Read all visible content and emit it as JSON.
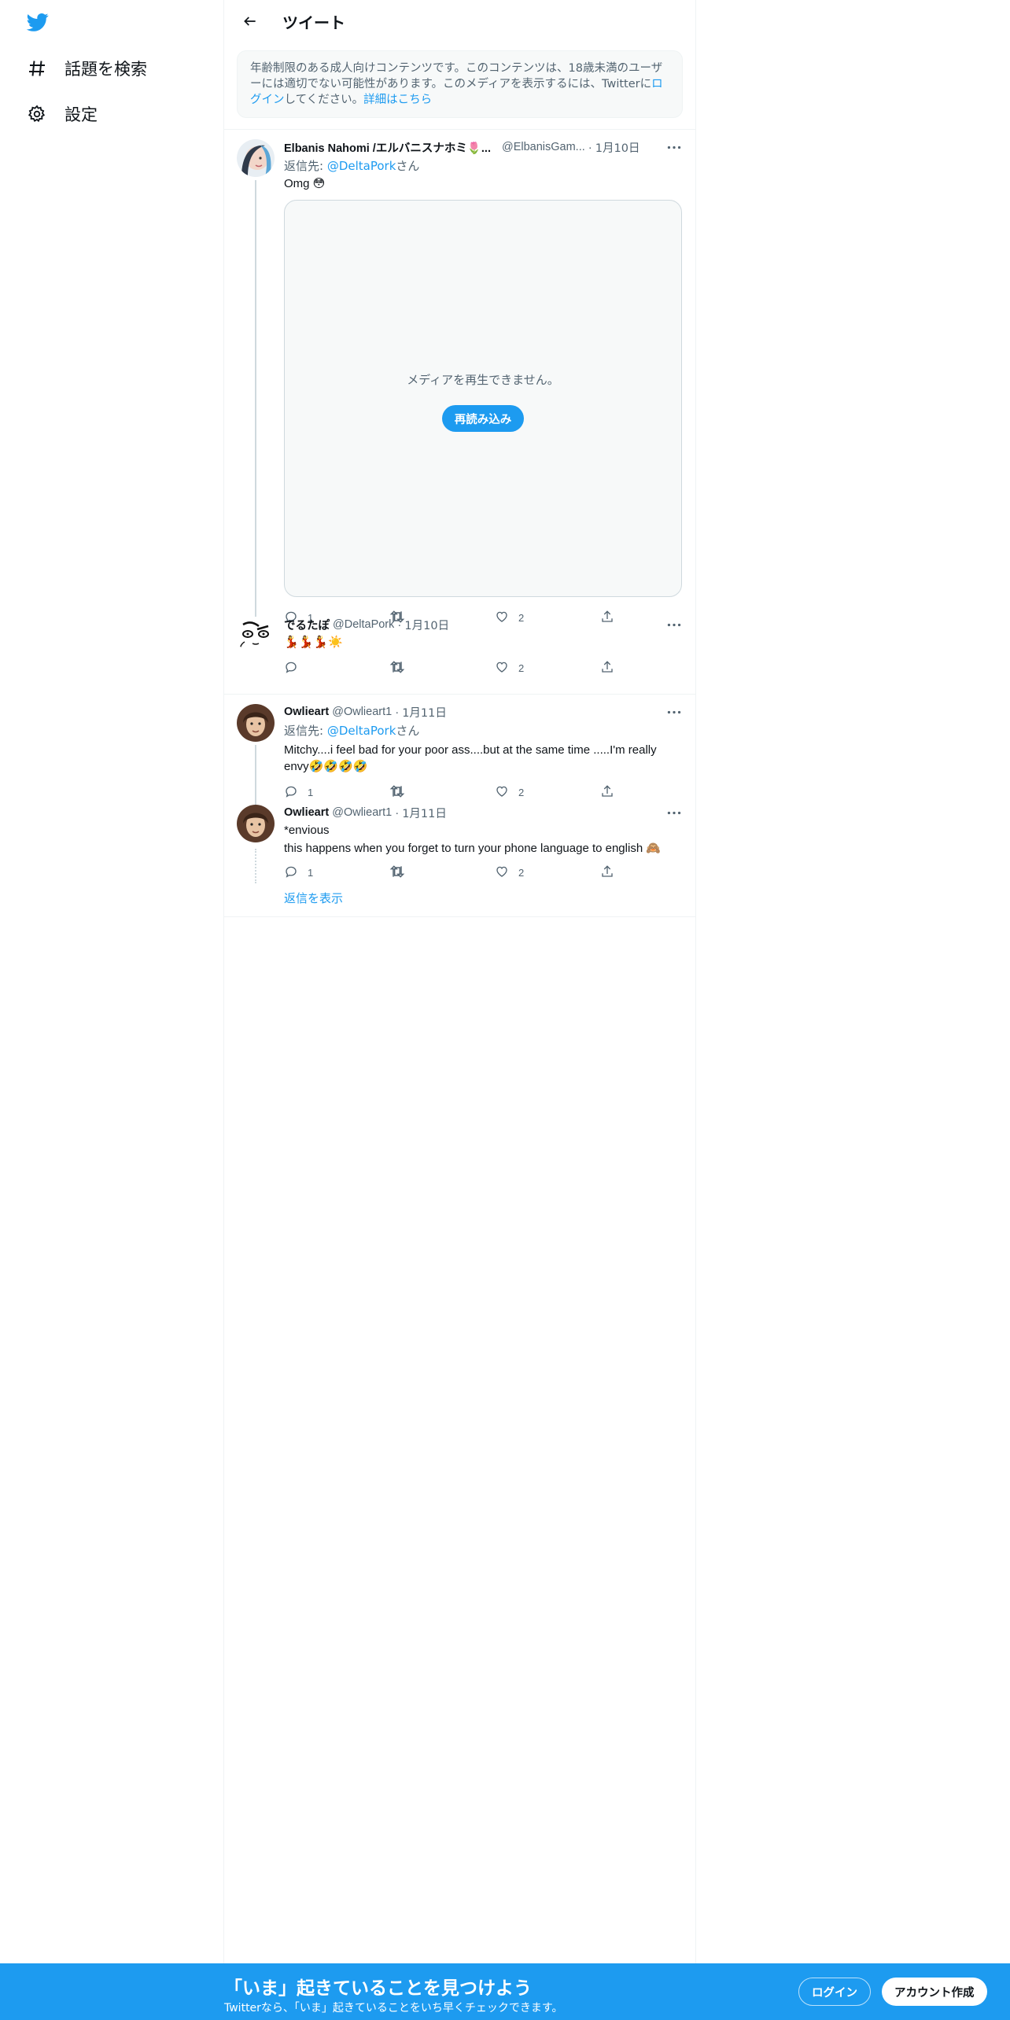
{
  "nav": {
    "logo_icon": "twitter-bird-icon",
    "items": [
      {
        "icon": "hashtag-icon",
        "label": "話題を検索"
      },
      {
        "icon": "gear-icon",
        "label": "設定"
      }
    ]
  },
  "header": {
    "title": "ツイート"
  },
  "warning": {
    "text": "年齢制限のある成人向けコンテンツです。このコンテンツは、18歳未満のユーザーには適切でない可能性があります。このメディアを表示するには、Twitterに",
    "login_link": "ログイン",
    "text2": "してください。",
    "more_link": "詳細はこちら"
  },
  "tweets": [
    {
      "name": "Elbanis Nahomi /エルバニスナホミ🌷...",
      "handle": "@ElbanisGam...",
      "dot": "·",
      "date": "1月10日",
      "replying_prefix": "返信先: ",
      "replying_to": "@DeltaPork",
      "replying_suffix": "さん",
      "text": "Omg 😳",
      "media": {
        "message": "メディアを再生できません。",
        "button": "再読み込み"
      },
      "replies": "1",
      "retweets": "",
      "likes": "2"
    },
    {
      "name": "でるたぽ",
      "handle": "@DeltaPork",
      "dot": "·",
      "date": "1月10日",
      "text": "💃💃💃☀️",
      "replies": "",
      "retweets": "",
      "likes": "2"
    },
    {
      "name": "Owlieart",
      "handle": "@Owlieart1",
      "dot": "·",
      "date": "1月11日",
      "replying_prefix": "返信先: ",
      "replying_to": "@DeltaPork",
      "replying_suffix": "さん",
      "text": "Mitchy....i feel bad for your poor ass....but at the same time .....I'm really envy🤣🤣🤣🤣",
      "replies": "1",
      "retweets": "",
      "likes": "2"
    },
    {
      "name": "Owlieart",
      "handle": "@Owlieart1",
      "dot": "·",
      "date": "1月11日",
      "text": "*envious",
      "text2": "this happens when you forget to turn your phone language to english 🙈",
      "replies": "1",
      "retweets": "",
      "likes": "2"
    }
  ],
  "show_replies": "返信を表示",
  "bottom_bar": {
    "title": "「いま」起きていることを見つけよう",
    "subtitle": "Twitterなら、「いま」起きていることをいち早くチェックできます。",
    "login": "ログイン",
    "signup": "アカウント作成"
  },
  "colors": {
    "accent": "#1d9bf0",
    "text": "#0f1419",
    "secondary": "#536471",
    "border": "#eff3f4"
  }
}
